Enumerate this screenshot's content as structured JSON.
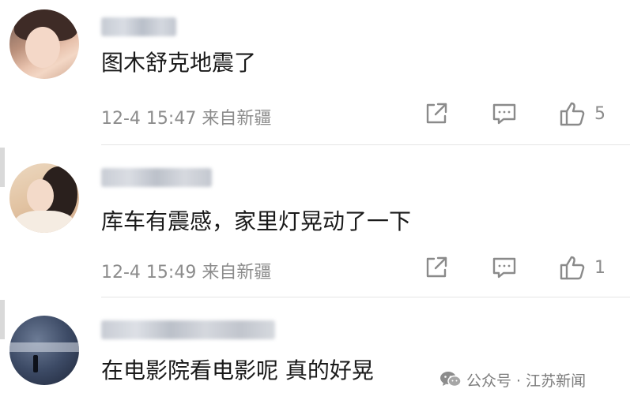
{
  "comments": [
    {
      "text": "图木舒克地震了",
      "meta": "12-4 15:47 来自新疆",
      "likes": "5"
    },
    {
      "text": "库车有震感，家里灯晃动了一下",
      "meta": "12-4 15:49 来自新疆",
      "likes": "1"
    },
    {
      "text": "在电影院看电影呢 真的好晃"
    }
  ],
  "watermark": {
    "label": "公众号 · 江苏新闻",
    "icon": "wechat-icon"
  },
  "icons": {
    "share": "share-icon",
    "comment": "comment-icon",
    "like": "thumbs-up-icon"
  },
  "colors": {
    "meta_text": "#8c8c8c",
    "divider": "#e6e6e6"
  }
}
